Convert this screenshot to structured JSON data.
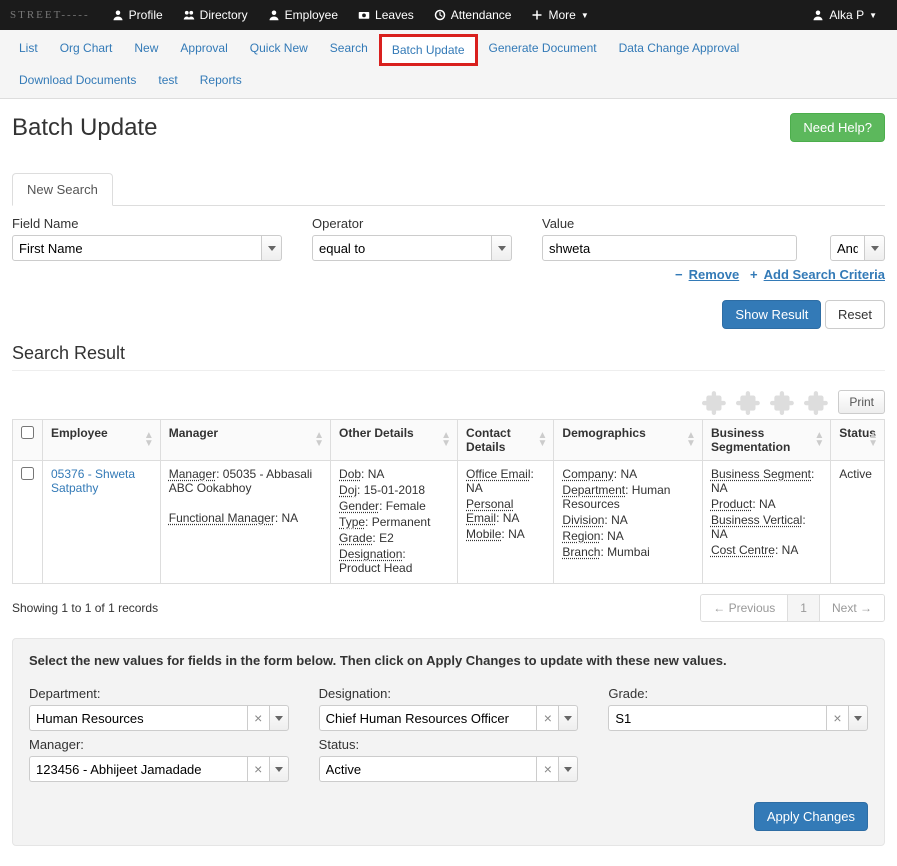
{
  "top_nav": {
    "logo": "STREET-----",
    "items": [
      "Profile",
      "Directory",
      "Employee",
      "Leaves",
      "Attendance",
      "More"
    ],
    "user": "Alka P"
  },
  "sub_nav": {
    "items": [
      "List",
      "Org Chart",
      "New",
      "Approval",
      "Quick New",
      "Search",
      "Batch Update",
      "Generate Document",
      "Data Change Approval",
      "Download Documents",
      "test",
      "Reports"
    ],
    "highlighted": "Batch Update"
  },
  "page": {
    "title": "Batch Update",
    "need_help_label": "Need Help?"
  },
  "tabs": {
    "new_search_label": "New Search"
  },
  "search": {
    "field_label": "Field Name",
    "field_value": "First Name",
    "operator_label": "Operator",
    "operator_value": "equal to",
    "value_label": "Value",
    "value_value": "shweta",
    "logic_value": "And",
    "remove_label": "Remove",
    "add_label": "Add Search Criteria",
    "show_result_label": "Show Result",
    "reset_label": "Reset"
  },
  "results": {
    "section_title": "Search Result",
    "print_label": "Print",
    "columns": [
      "",
      "Employee",
      "Manager",
      "Other Details",
      "Contact Details",
      "Demographics",
      "Business Segmentation",
      "Status"
    ],
    "row": {
      "employee_link": "05376 - Shweta Satpathy",
      "manager": {
        "manager_label": "Manager",
        "manager_value": "05035 - Abbasali ABC Ookabhoy",
        "func_mgr_label": "Functional Manager",
        "func_mgr_value": "NA"
      },
      "other": {
        "dob_label": "Dob",
        "dob_value": "NA",
        "doj_label": "Doj",
        "doj_value": "15-01-2018",
        "gender_label": "Gender",
        "gender_value": "Female",
        "type_label": "Type",
        "type_value": "Permanent",
        "grade_label": "Grade",
        "grade_value": "E2",
        "designation_label": "Designation",
        "designation_value": "Product Head"
      },
      "contact": {
        "office_email_label": "Office Email",
        "office_email_value": "NA",
        "personal_email_label": "Personal Email",
        "personal_email_value": "NA",
        "mobile_label": "Mobile",
        "mobile_value": "NA"
      },
      "demo": {
        "company_label": "Company",
        "company_value": "NA",
        "department_label": "Department",
        "department_value": "Human Resources",
        "division_label": "Division",
        "division_value": "NA",
        "region_label": "Region",
        "region_value": "NA",
        "branch_label": "Branch",
        "branch_value": "Mumbai"
      },
      "biz": {
        "bs_label": "Business Segment",
        "bs_value": "NA",
        "product_label": "Product",
        "product_value": "NA",
        "bv_label": "Business Vertical",
        "bv_value": "NA",
        "cc_label": "Cost Centre",
        "cc_value": "NA"
      },
      "status": "Active"
    },
    "showing_text": "Showing 1 to 1 of 1 records",
    "pager": {
      "prev": "← Previous",
      "page": "1",
      "next": "Next →"
    }
  },
  "update_panel": {
    "instruction": "Select the new values for fields in the form below. Then click on Apply Changes to update with these new values.",
    "department_label": "Department:",
    "department_value": "Human Resources",
    "designation_label": "Designation:",
    "designation_value": "Chief Human Resources Officer",
    "grade_label": "Grade:",
    "grade_value": "S1",
    "manager_label": "Manager:",
    "manager_value": "123456 - Abhijeet Jamadade",
    "status_label": "Status:",
    "status_value": "Active",
    "apply_label": "Apply Changes"
  }
}
